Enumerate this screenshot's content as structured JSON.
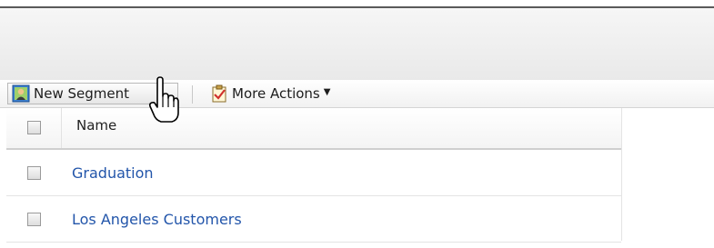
{
  "toolbar": {
    "new_segment_label": "New Segment",
    "more_actions_label": "More Actions",
    "new_segment_icon": "new-segment-icon",
    "more_actions_icon": "clipboard-check-icon"
  },
  "grid": {
    "columns": [
      "Name"
    ],
    "rows": [
      {
        "name": "Graduation"
      },
      {
        "name": "Los Angeles Customers"
      }
    ]
  },
  "colors": {
    "link": "#2255aa",
    "border": "#cfcfcf"
  }
}
